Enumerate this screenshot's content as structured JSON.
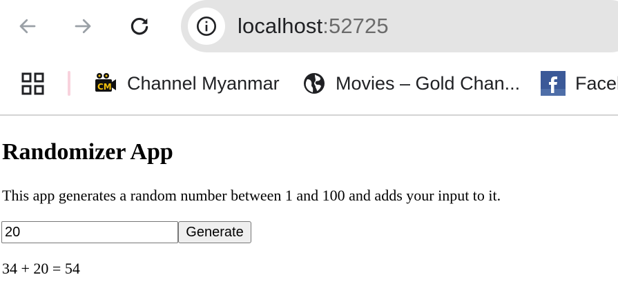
{
  "browser": {
    "nav": {
      "back_icon": "arrow-left-icon",
      "forward_icon": "arrow-right-icon",
      "reload_icon": "reload-icon"
    },
    "address_bar": {
      "site_info_icon": "info-icon",
      "host": "localhost",
      "port": ":52725"
    },
    "bookmarks": {
      "apps_icon": "apps-grid-icon",
      "items": [
        {
          "label": "Channel Myanmar",
          "icon": "channel-myanmar-icon"
        },
        {
          "label": "Movies – Gold Chan...",
          "icon": "globe-icon"
        },
        {
          "label": "Faceb",
          "icon": "facebook-icon"
        }
      ]
    }
  },
  "page": {
    "title": "Randomizer App",
    "description": "This app generates a random number between 1 and 100 and adds your input to it.",
    "input_value": "20",
    "button_label": "Generate",
    "result": "34 + 20 = 54"
  },
  "colors": {
    "omnibox_bg": "#e4e4e4",
    "separator_pink": "#f8d2dd",
    "icon_dark": "#202124",
    "facebook_blue": "#3b5998"
  }
}
